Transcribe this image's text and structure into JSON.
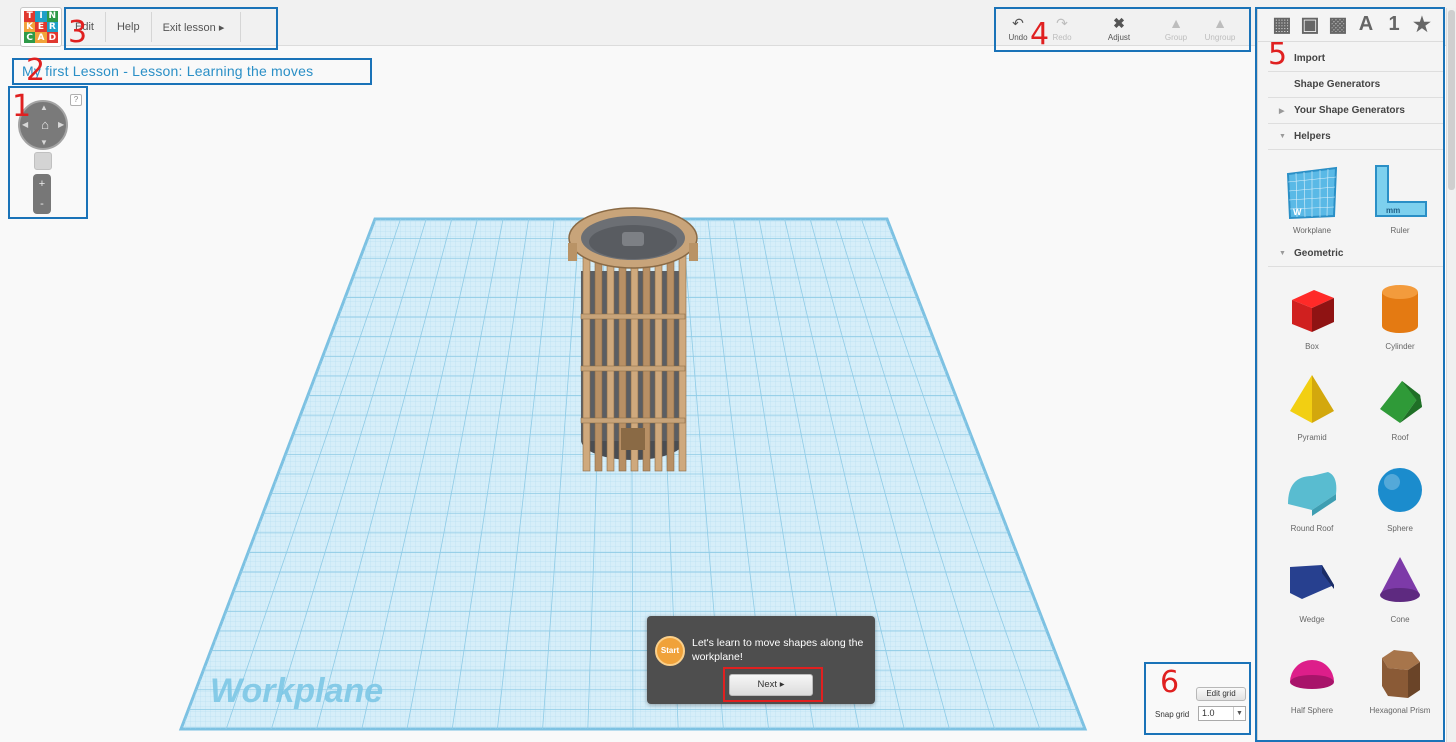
{
  "logo": {
    "letters": [
      "T",
      "I",
      "N",
      "K",
      "E",
      "R",
      "C",
      "A",
      "D"
    ]
  },
  "menu": {
    "items": [
      {
        "label": "Edit"
      },
      {
        "label": "Help"
      },
      {
        "label": "Exit lesson ▸"
      }
    ]
  },
  "toolbar": {
    "undo": "Undo",
    "redo": "Redo",
    "adjust": "Adjust",
    "group": "Group",
    "ungroup": "Ungroup"
  },
  "lesson": {
    "title": "My first Lesson - Lesson: Learning the moves",
    "popup_badge": "Start",
    "popup_text": "Let's learn to move shapes along the workplane!",
    "next_label": "Next ▸"
  },
  "canvas": {
    "workplane_label": "Workplane"
  },
  "view_controls": {
    "help": "?",
    "zoom_in": "+",
    "zoom_out": "-"
  },
  "grid": {
    "edit_label": "Edit grid",
    "snap_label": "Snap grid",
    "snap_value": "1.0"
  },
  "sidebar": {
    "tabs": [
      {
        "icon": "workplane-tab-icon",
        "glyph": "▦"
      },
      {
        "icon": "cube-tab-icon",
        "glyph": "▣"
      },
      {
        "icon": "components-tab-icon",
        "glyph": "▩"
      },
      {
        "icon": "text-tab-icon",
        "glyph": "A"
      },
      {
        "icon": "number-tab-icon",
        "glyph": "1"
      },
      {
        "icon": "star-tab-icon",
        "glyph": "★"
      }
    ],
    "rows": {
      "import": "Import",
      "shape_generators": "Shape Generators",
      "your_shape_generators": "Your Shape Generators",
      "helpers": "Helpers",
      "geometric": "Geometric"
    },
    "helpers": [
      {
        "label": "Workplane",
        "icon": "workplane-helper-icon"
      },
      {
        "label": "Ruler",
        "icon": "ruler-helper-icon"
      }
    ],
    "shapes": [
      {
        "label": "Box",
        "color": "#d0201f"
      },
      {
        "label": "Cylinder",
        "color": "#e47a12"
      },
      {
        "label": "Pyramid",
        "color": "#f2cf12"
      },
      {
        "label": "Roof",
        "color": "#2f9a38"
      },
      {
        "label": "Round Roof",
        "color": "#59bcd0"
      },
      {
        "label": "Sphere",
        "color": "#1b8ccd"
      },
      {
        "label": "Wedge",
        "color": "#27408f"
      },
      {
        "label": "Cone",
        "color": "#7d3aa8"
      },
      {
        "label": "Half Sphere",
        "color": "#dd1e8a"
      },
      {
        "label": "Hexagonal Prism",
        "color": "#8a5a36"
      }
    ]
  },
  "annotations": [
    "1",
    "2",
    "3",
    "4",
    "5",
    "6"
  ],
  "colors": {
    "accent_blue": "#2a8fc6",
    "annotation_box": "#1a73b8",
    "annotation_mark": "#e02020",
    "workplane_fill": "#cfeaf7",
    "tower_wood": "#c8a47a"
  }
}
